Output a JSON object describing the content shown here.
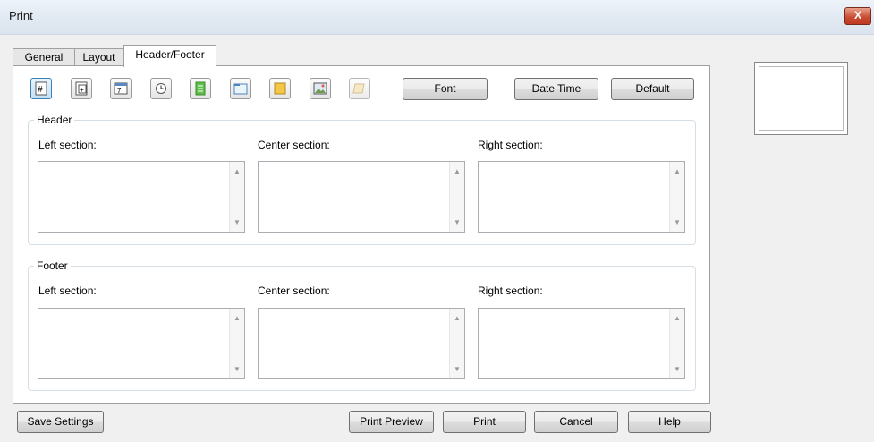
{
  "window": {
    "title": "Print",
    "close_label": "X"
  },
  "tabs": [
    {
      "label": "General"
    },
    {
      "label": "Layout"
    },
    {
      "label": "Header/Footer"
    }
  ],
  "toolbar": {
    "icons": [
      "page-number-icon",
      "total-pages-icon",
      "date-icon",
      "time-icon",
      "file-path-icon",
      "folder-icon",
      "sheet-name-icon",
      "picture-icon",
      "format-picture-icon"
    ],
    "font_label": "Font",
    "datetime_label": "Date  Time",
    "default_label": "Default"
  },
  "header": {
    "title": "Header",
    "left_label": "Left section:",
    "center_label": "Center section:",
    "right_label": "Right section:",
    "left_value": "",
    "center_value": "",
    "right_value": ""
  },
  "footer": {
    "title": "Footer",
    "left_label": "Left section:",
    "center_label": "Center section:",
    "right_label": "Right section:",
    "left_value": "",
    "center_value": "",
    "right_value": ""
  },
  "bottom": {
    "save_settings": "Save Settings",
    "print_preview": "Print Preview",
    "print": "Print",
    "cancel": "Cancel",
    "help": "Help"
  },
  "colors": {
    "selected_accent": "#3c7fb1",
    "close_red": "#c74a30"
  }
}
